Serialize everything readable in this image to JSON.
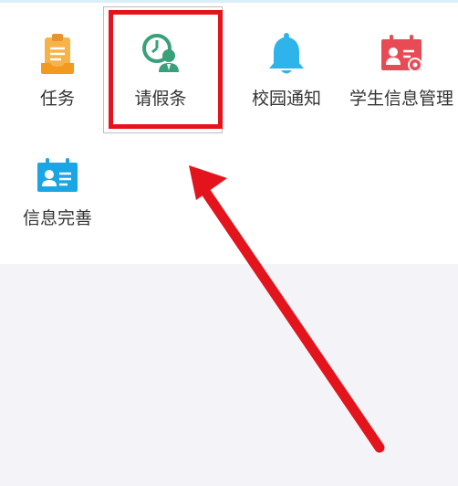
{
  "grid": {
    "items": [
      {
        "id": "task",
        "label": "任务",
        "icon": "task-clipboard-icon",
        "color": "#f5a623"
      },
      {
        "id": "leave",
        "label": "请假条",
        "icon": "leave-clock-person-icon",
        "color": "#3aa07a"
      },
      {
        "id": "notice",
        "label": "校园通知",
        "icon": "bell-icon",
        "color": "#2eb3ea"
      },
      {
        "id": "student",
        "label": "学生信息管理",
        "icon": "student-card-gear-icon",
        "color": "#e84b56"
      },
      {
        "id": "info",
        "label": "信息完善",
        "icon": "id-card-icon",
        "color": "#1aa6e4"
      }
    ]
  },
  "annotation": {
    "highlight_color": "#e3141c",
    "highlighted_item": "请假条",
    "arrow": "pointing-up-left-to-highlighted-item"
  }
}
